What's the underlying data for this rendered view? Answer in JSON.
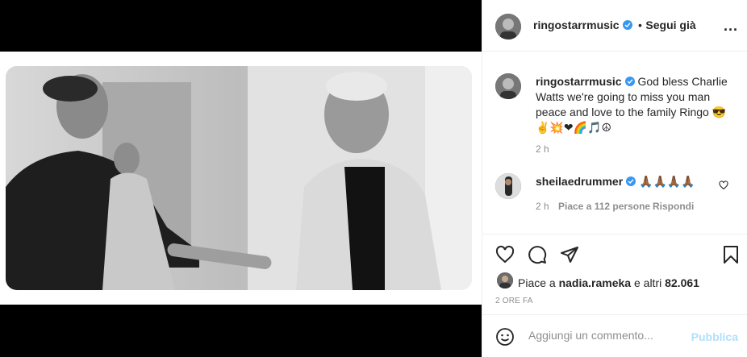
{
  "header": {
    "username": "ringostarrmusic",
    "separator": "•",
    "follow_label": "Segui già",
    "more_label": "..."
  },
  "caption": {
    "username": "ringostarrmusic",
    "text": "God bless Charlie Watts we're going to miss you man peace and love to the family Ringo",
    "emoji": "😎✌💥❤🌈🎵☮",
    "time": "2 h"
  },
  "comments": [
    {
      "username": "sheilaedrummer",
      "text": "🙏🏾🙏🏾🙏🏾🙏🏾",
      "time": "2 h",
      "likes": "Piace a 112 persone",
      "reply_label": "Rispondi"
    }
  ],
  "likes": {
    "prefix": "Piace a",
    "user": "nadia.rameka",
    "suffix": "e altri",
    "count": "82.061"
  },
  "posted_ago": "2 ORE FA",
  "add_comment": {
    "placeholder": "Aggiungi un commento...",
    "publish_label": "Pubblica"
  },
  "icons": {
    "verified": "verified-badge-icon",
    "like": "heart-icon",
    "comment": "comment-bubble-icon",
    "share": "paper-plane-icon",
    "save": "bookmark-icon",
    "emoji": "smiley-icon",
    "comment_like": "small-heart-icon"
  },
  "colors": {
    "verified": "#3897f0",
    "publish_disabled": "#b2dffc",
    "muted": "#8e8e8e",
    "text": "#262626"
  }
}
